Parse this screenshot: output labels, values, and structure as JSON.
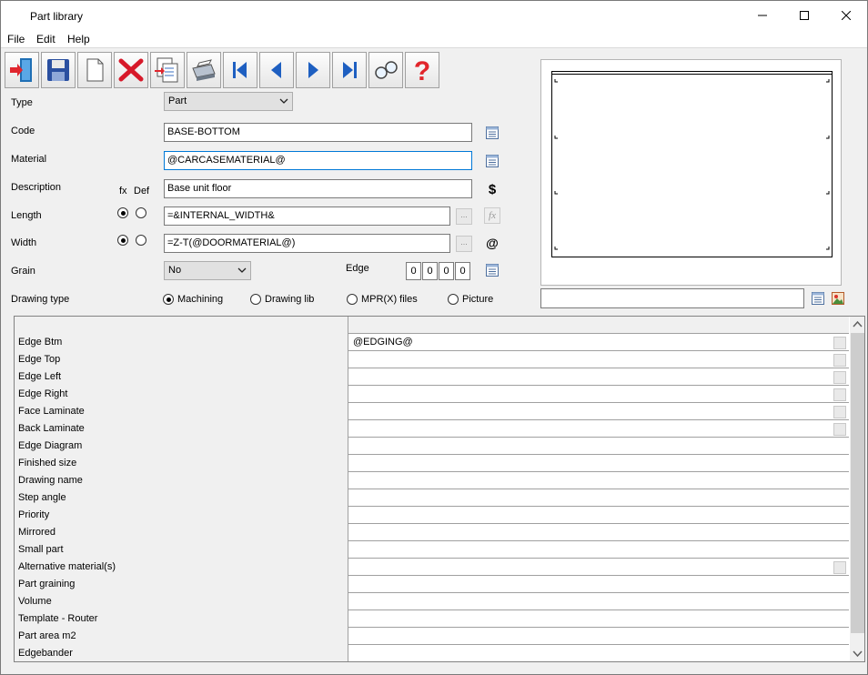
{
  "window": {
    "title": "Part library"
  },
  "menu": [
    "File",
    "Edit",
    "Help"
  ],
  "toolbar": [
    {
      "name": "exit-icon"
    },
    {
      "name": "save-icon"
    },
    {
      "name": "new-icon"
    },
    {
      "name": "delete-icon"
    },
    {
      "name": "copy-icon"
    },
    {
      "name": "print-icon"
    },
    {
      "name": "first-record-icon"
    },
    {
      "name": "previous-record-icon"
    },
    {
      "name": "next-record-icon"
    },
    {
      "name": "last-record-icon"
    },
    {
      "name": "search-icon"
    },
    {
      "name": "help-icon"
    }
  ],
  "form": {
    "type_label": "Type",
    "type_value": "Part",
    "code_label": "Code",
    "code_value": "BASE-BOTTOM",
    "material_label": "Material",
    "material_value": "@CARCASEMATERIAL@",
    "description_label": "Description",
    "description_value": "Base unit floor",
    "fx_label": "fx",
    "def_label": "Def",
    "length_label": "Length",
    "length_value": "=&INTERNAL_WIDTH&",
    "width_label": "Width",
    "width_value": "=Z-T(@DOORMATERIAL@)",
    "grain_label": "Grain",
    "grain_value": "No",
    "edge_label": "Edge",
    "edge_values": [
      "0",
      "0",
      "0",
      "0"
    ],
    "ellipsis": "...",
    "dollar": "$",
    "fx_symbol": "fx",
    "at_symbol": "@",
    "drawing_type_label": "Drawing type",
    "drawing_types": [
      "Machining",
      "Drawing lib",
      "MPR(X) files",
      "Picture"
    ],
    "drawing_type_selected": "Machining"
  },
  "preview_field": "",
  "grid": {
    "rows": [
      {
        "name": "Edge Btm",
        "value": "@EDGING@",
        "button": true
      },
      {
        "name": "Edge Top",
        "value": "",
        "button": true
      },
      {
        "name": "Edge Left",
        "value": "",
        "button": true
      },
      {
        "name": "Edge Right",
        "value": "",
        "button": true
      },
      {
        "name": "Face Laminate",
        "value": "",
        "button": true
      },
      {
        "name": "Back Laminate",
        "value": "",
        "button": true
      },
      {
        "name": "Edge Diagram",
        "value": "",
        "button": false
      },
      {
        "name": "Finished size",
        "value": "",
        "button": false
      },
      {
        "name": "Drawing name",
        "value": "",
        "button": false
      },
      {
        "name": "Step angle",
        "value": "",
        "button": false
      },
      {
        "name": "Priority",
        "value": "",
        "button": false
      },
      {
        "name": "Mirrored",
        "value": "",
        "button": false
      },
      {
        "name": "Small part",
        "value": "",
        "button": false
      },
      {
        "name": "Alternative material(s)",
        "value": "",
        "button": true
      },
      {
        "name": "Part graining",
        "value": "",
        "button": false
      },
      {
        "name": "Volume",
        "value": "",
        "button": false
      },
      {
        "name": "Template - Router",
        "value": "",
        "button": false
      },
      {
        "name": "Part area m2",
        "value": "",
        "button": false
      },
      {
        "name": "Edgebander",
        "value": "",
        "button": false
      }
    ]
  }
}
